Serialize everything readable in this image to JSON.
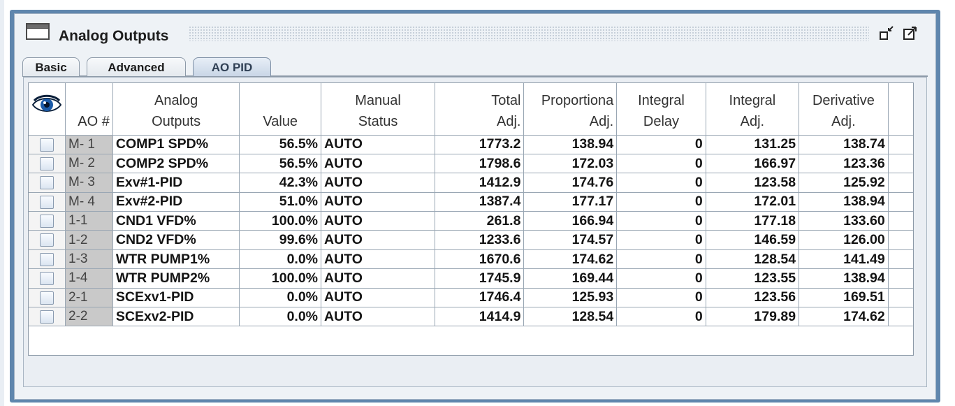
{
  "window": {
    "title": "Analog Outputs",
    "buttons": [
      "minimize-icon",
      "maximize-icon"
    ]
  },
  "tabs": [
    {
      "label": "Basic",
      "active": false
    },
    {
      "label": "Advanced",
      "active": false
    },
    {
      "label": "AO PID",
      "active": true
    }
  ],
  "table": {
    "headers": {
      "ao": "AO #",
      "outputs": [
        "Analog",
        "Outputs"
      ],
      "value": "Value",
      "manual": [
        "Manual",
        "Status"
      ],
      "total": [
        "Total",
        "Adj."
      ],
      "prop": [
        "Proportiona",
        "Adj."
      ],
      "delay": [
        "Integral",
        "Delay"
      ],
      "iadj": [
        "Integral",
        "Adj."
      ],
      "deriv": [
        "Derivative",
        "Adj."
      ]
    },
    "rows": [
      {
        "ao": "M- 1",
        "name": "COMP1 SPD%",
        "value": "56.5%",
        "status": "AUTO",
        "total": "1773.2",
        "prop": "138.94",
        "delay": "0",
        "iadj": "131.25",
        "deriv": "138.74"
      },
      {
        "ao": "M- 2",
        "name": "COMP2 SPD%",
        "value": "56.5%",
        "status": "AUTO",
        "total": "1798.6",
        "prop": "172.03",
        "delay": "0",
        "iadj": "166.97",
        "deriv": "123.36"
      },
      {
        "ao": "M- 3",
        "name": "Exv#1-PID",
        "value": "42.3%",
        "status": "AUTO",
        "total": "1412.9",
        "prop": "174.76",
        "delay": "0",
        "iadj": "123.58",
        "deriv": "125.92"
      },
      {
        "ao": "M- 4",
        "name": "Exv#2-PID",
        "value": "51.0%",
        "status": "AUTO",
        "total": "1387.4",
        "prop": "177.17",
        "delay": "0",
        "iadj": "172.01",
        "deriv": "138.94"
      },
      {
        "ao": "1-1",
        "name": "CND1 VFD%",
        "value": "100.0%",
        "status": "AUTO",
        "total": "261.8",
        "prop": "166.94",
        "delay": "0",
        "iadj": "177.18",
        "deriv": "133.60"
      },
      {
        "ao": "1-2",
        "name": "CND2 VFD%",
        "value": "99.6%",
        "status": "AUTO",
        "total": "1233.6",
        "prop": "174.57",
        "delay": "0",
        "iadj": "146.59",
        "deriv": "126.00"
      },
      {
        "ao": "1-3",
        "name": "WTR PUMP1%",
        "value": "0.0%",
        "status": "AUTO",
        "total": "1670.6",
        "prop": "174.62",
        "delay": "0",
        "iadj": "128.54",
        "deriv": "141.49"
      },
      {
        "ao": "1-4",
        "name": "WTR PUMP2%",
        "value": "100.0%",
        "status": "AUTO",
        "total": "1745.9",
        "prop": "169.44",
        "delay": "0",
        "iadj": "123.55",
        "deriv": "138.94"
      },
      {
        "ao": "2-1",
        "name": "SCExv1-PID",
        "value": "0.0%",
        "status": "AUTO",
        "total": "1746.4",
        "prop": "125.93",
        "delay": "0",
        "iadj": "123.56",
        "deriv": "169.51"
      },
      {
        "ao": "2-2",
        "name": "SCExv2-PID",
        "value": "0.0%",
        "status": "AUTO",
        "total": "1414.9",
        "prop": "128.54",
        "delay": "0",
        "iadj": "179.89",
        "deriv": "174.62"
      }
    ]
  },
  "icons": {
    "header": "eye-icon",
    "window": "window-icon"
  }
}
